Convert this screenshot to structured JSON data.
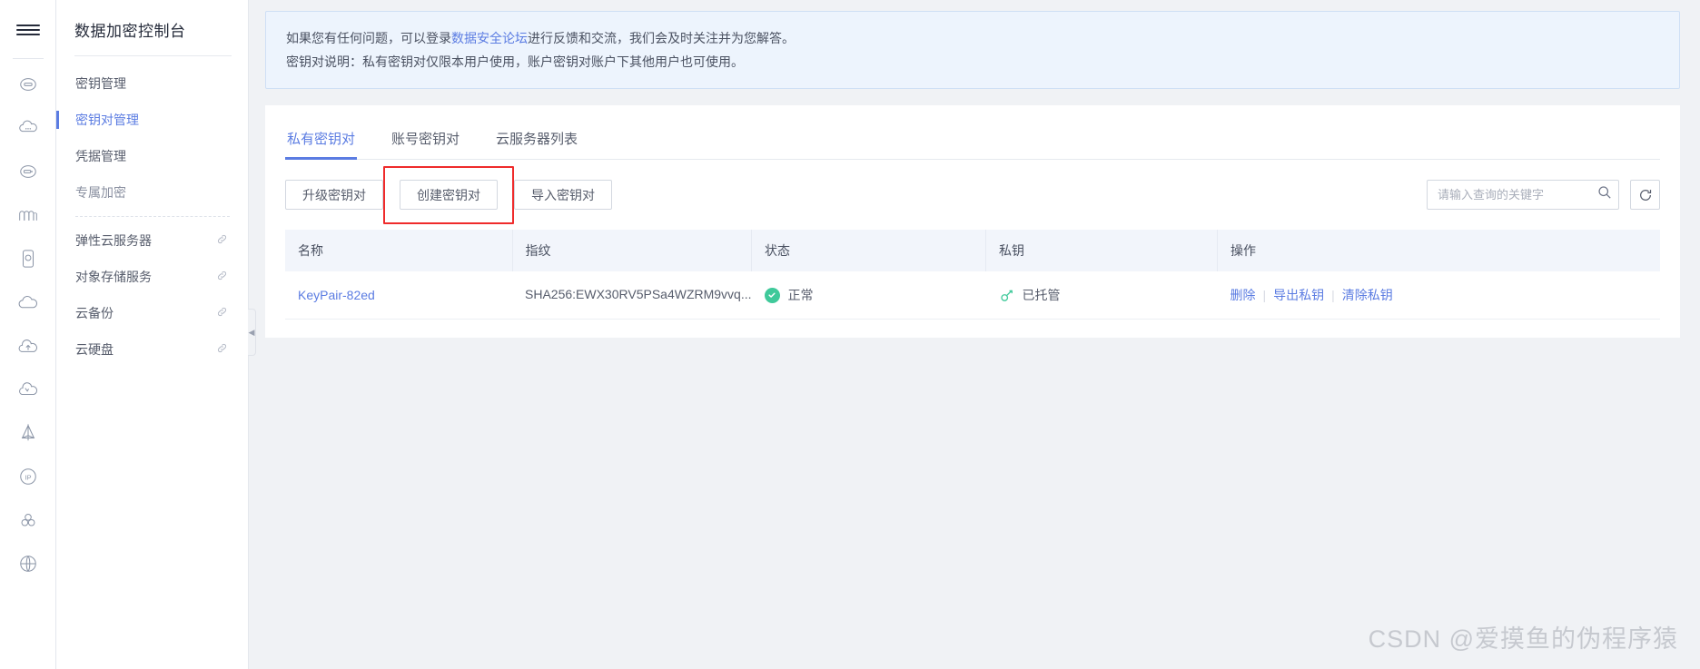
{
  "rail": {
    "menu_icon": "hamburger-menu-icon",
    "icons": [
      "cloud-server-icon",
      "cloud-dots-icon",
      "cloud-storage-icon",
      "waveform-icon",
      "device-cloud-icon",
      "cloud-outline-icon",
      "cloud-upload-icon",
      "cloud-arrow-icon",
      "pyramid-icon",
      "ip-circle-icon",
      "cluster-icon",
      "globe-web-icon"
    ]
  },
  "sidebar": {
    "title": "数据加密控制台",
    "items": [
      {
        "label": "密钥管理",
        "active": false,
        "external": false,
        "muted": false
      },
      {
        "label": "密钥对管理",
        "active": true,
        "external": false,
        "muted": false
      },
      {
        "label": "凭据管理",
        "active": false,
        "external": false,
        "muted": false
      },
      {
        "label": "专属加密",
        "active": false,
        "external": false,
        "muted": true
      },
      {
        "label": "弹性云服务器",
        "active": false,
        "external": true,
        "muted": false
      },
      {
        "label": "对象存储服务",
        "active": false,
        "external": true,
        "muted": false
      },
      {
        "label": "云备份",
        "active": false,
        "external": true,
        "muted": false
      },
      {
        "label": "云硬盘",
        "active": false,
        "external": true,
        "muted": false
      }
    ],
    "collapse_icon": "◀"
  },
  "notice": {
    "line1_prefix": "如果您有任何问题，可以登录",
    "line1_link": "数据安全论坛",
    "line1_suffix": "进行反馈和交流，我们会及时关注并为您解答。",
    "line2": "密钥对说明：私有密钥对仅限本用户使用，账户密钥对账户下其他用户也可使用。"
  },
  "tabs": [
    {
      "label": "私有密钥对",
      "active": true
    },
    {
      "label": "账号密钥对",
      "active": false
    },
    {
      "label": "云服务器列表",
      "active": false
    }
  ],
  "toolbar": {
    "upgrade_label": "升级密钥对",
    "create_label": "创建密钥对",
    "import_label": "导入密钥对",
    "highlighted_button": "创建密钥对",
    "highlight_color": "#ef2b2b",
    "search_placeholder": "请输入查询的关键字",
    "search_value": "",
    "search_icon": "search-icon",
    "refresh_icon": "refresh-icon"
  },
  "table": {
    "columns": [
      "名称",
      "指纹",
      "状态",
      "私钥",
      "操作"
    ],
    "rows": [
      {
        "name": "KeyPair-82ed",
        "fingerprint": "SHA256:EWX30RV5PSa4WZRM9vvq...",
        "status": "正常",
        "status_icon": "check-circle-icon",
        "private_key": "已托管",
        "private_key_icon": "key-icon",
        "actions": [
          "删除",
          "导出私钥",
          "清除私钥"
        ]
      }
    ]
  },
  "watermark": "CSDN @爱摸鱼的伪程序猿",
  "colors": {
    "accent": "#5b7ce2",
    "success": "#3fc99a",
    "danger": "#ef2b2b",
    "notice_bg": "#edf4fd"
  }
}
